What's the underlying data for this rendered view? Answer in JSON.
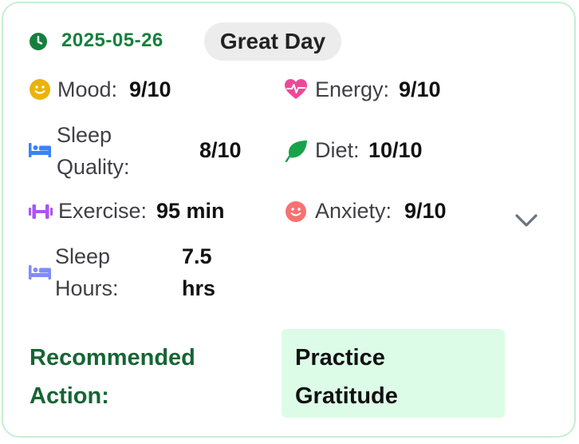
{
  "entry": {
    "date": "2025-05-26",
    "day_label": "Great Day"
  },
  "metrics": {
    "mood": {
      "label": "Mood:",
      "value": "9/10",
      "icon": "smiley-icon",
      "color": "#eab308"
    },
    "energy": {
      "label": "Energy:",
      "value": "9/10",
      "icon": "heart-pulse-icon",
      "color": "#ec4899"
    },
    "sleep_quality": {
      "label_line1": "Sleep",
      "label_line2": "Quality:",
      "value": "8/10",
      "icon": "bed-icon",
      "color": "#3b82f6"
    },
    "diet": {
      "label": "Diet:",
      "value": "10/10",
      "icon": "leaf-icon",
      "color": "#16a34a"
    },
    "exercise": {
      "label": "Exercise:",
      "value": "95 min",
      "icon": "dumbbell-icon",
      "color": "#a855f7"
    },
    "anxiety": {
      "label": "Anxiety:",
      "value": "9/10",
      "icon": "smiley-icon",
      "color": "#f87171"
    },
    "sleep_hours": {
      "label_line1": "Sleep",
      "label_line2": "Hours:",
      "value_line1": "7.5",
      "value_line2": "hrs",
      "icon": "bed-icon",
      "color": "#818cf8"
    }
  },
  "recommendation": {
    "label_line1": "Recommended",
    "label_line2": "Action:",
    "text_line1": "Practice",
    "text_line2": "Gratitude"
  },
  "colors": {
    "date": "#15803d",
    "card_border": "#c5efd3",
    "recommendation_bg": "#dcfce7"
  }
}
